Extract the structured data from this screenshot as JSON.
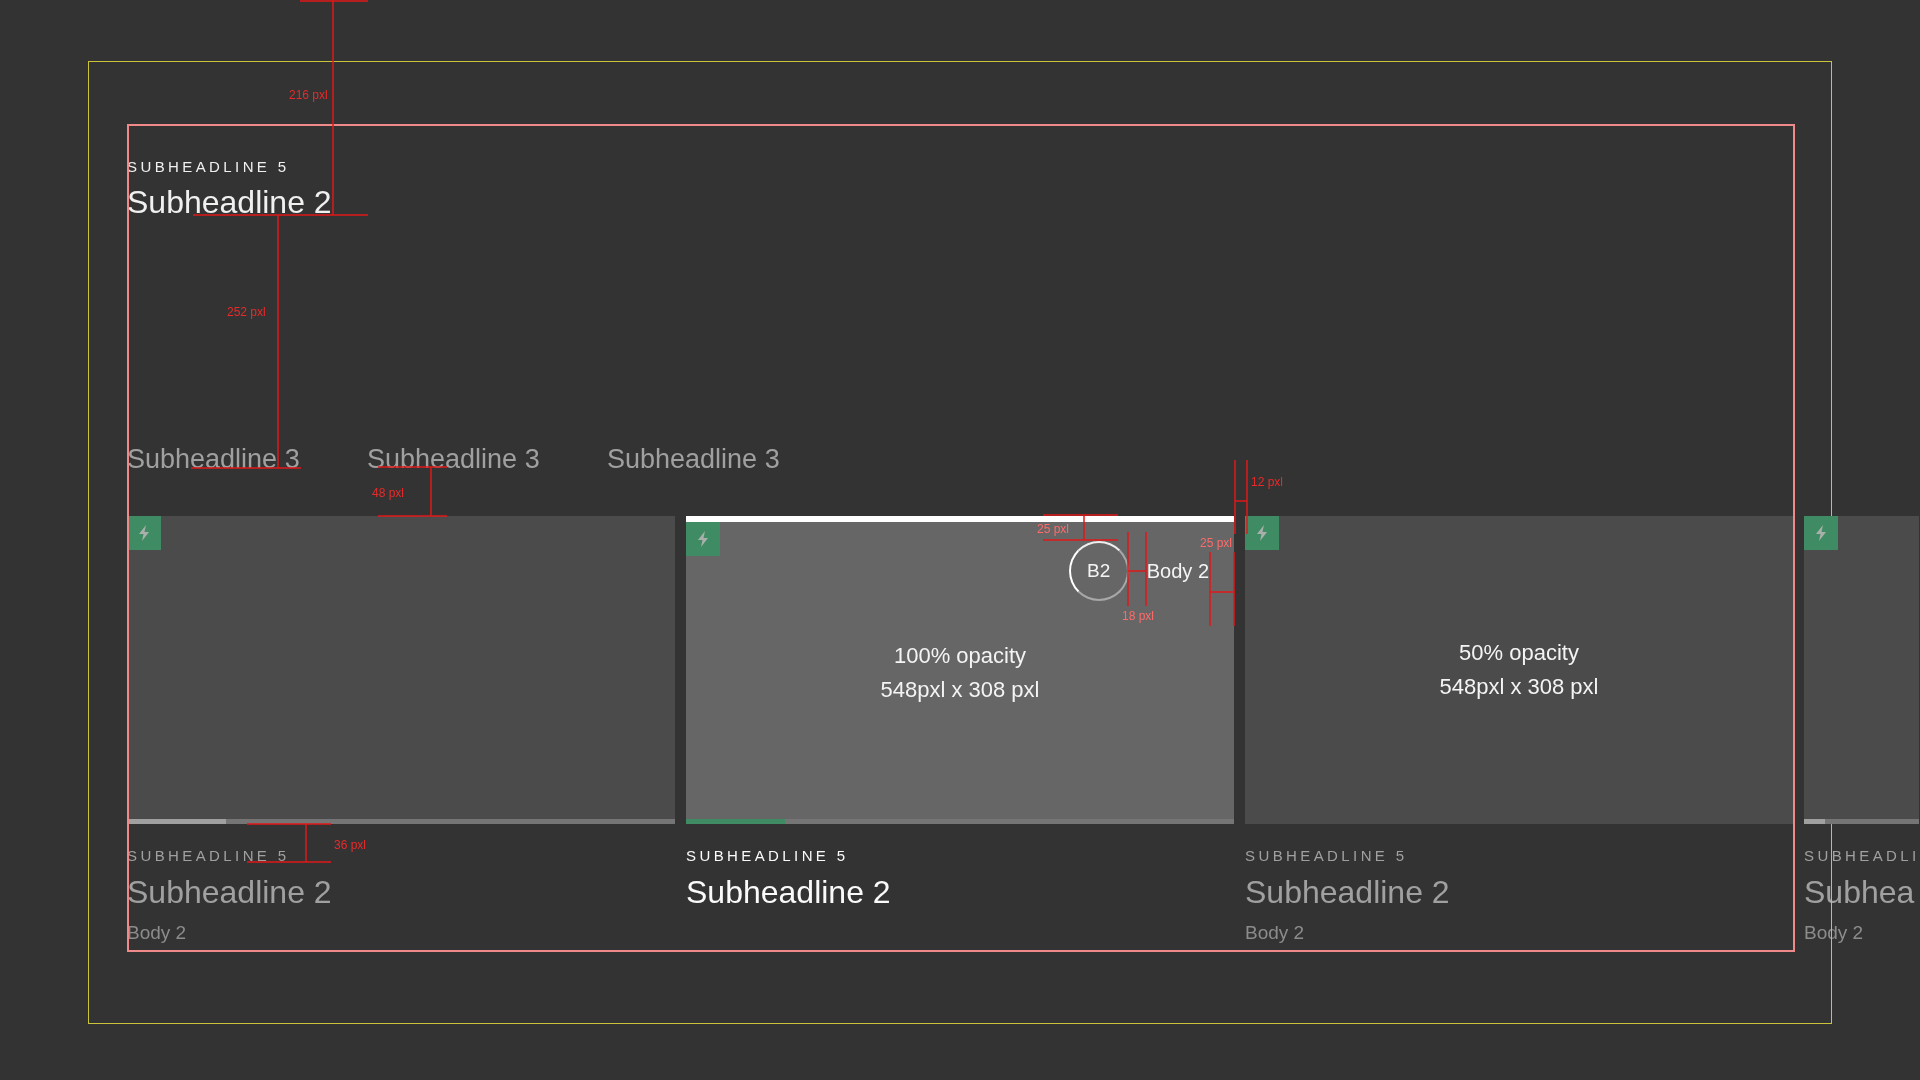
{
  "header": {
    "overline": "SUBHEADLINE 5",
    "title": "Subheadline 2"
  },
  "tabs": [
    {
      "label": "Subheadline 3",
      "selected": false
    },
    {
      "label": "Subheadline 3",
      "selected": false
    },
    {
      "label": "Subheadline 3",
      "selected": false
    }
  ],
  "cards": [
    {
      "selected": false,
      "level": 0.18,
      "overline": "SUBHEADLINE 5",
      "title": "Subheadline 2",
      "body": "Body 2"
    },
    {
      "selected": true,
      "level": 0.18,
      "notes": [
        "100% opacity",
        "548pxl x 308 pxl"
      ],
      "avatar": {
        "initials": "B2",
        "label": "Body 2"
      },
      "overline": "SUBHEADLINE 5",
      "title": "Subheadline 2"
    },
    {
      "selected": false,
      "notes": [
        "50% opacity",
        "548pxl x 308 pxl"
      ],
      "overline": "SUBHEADLINE 5",
      "title": "Subheadline 2",
      "body": "Body 2"
    },
    {
      "selected": false,
      "level": 0.18,
      "overline": "SUBHEADLI",
      "title": "Subhea",
      "body": "Body 2"
    }
  ],
  "annotations": [
    {
      "label": "216 pxl"
    },
    {
      "label": "252 pxl"
    },
    {
      "label": "48 pxl"
    },
    {
      "label": "25 pxl"
    },
    {
      "label": "18 pxl"
    },
    {
      "label": "25 pxl"
    },
    {
      "label": "12 pxl"
    },
    {
      "label": "36 pxl"
    }
  ]
}
